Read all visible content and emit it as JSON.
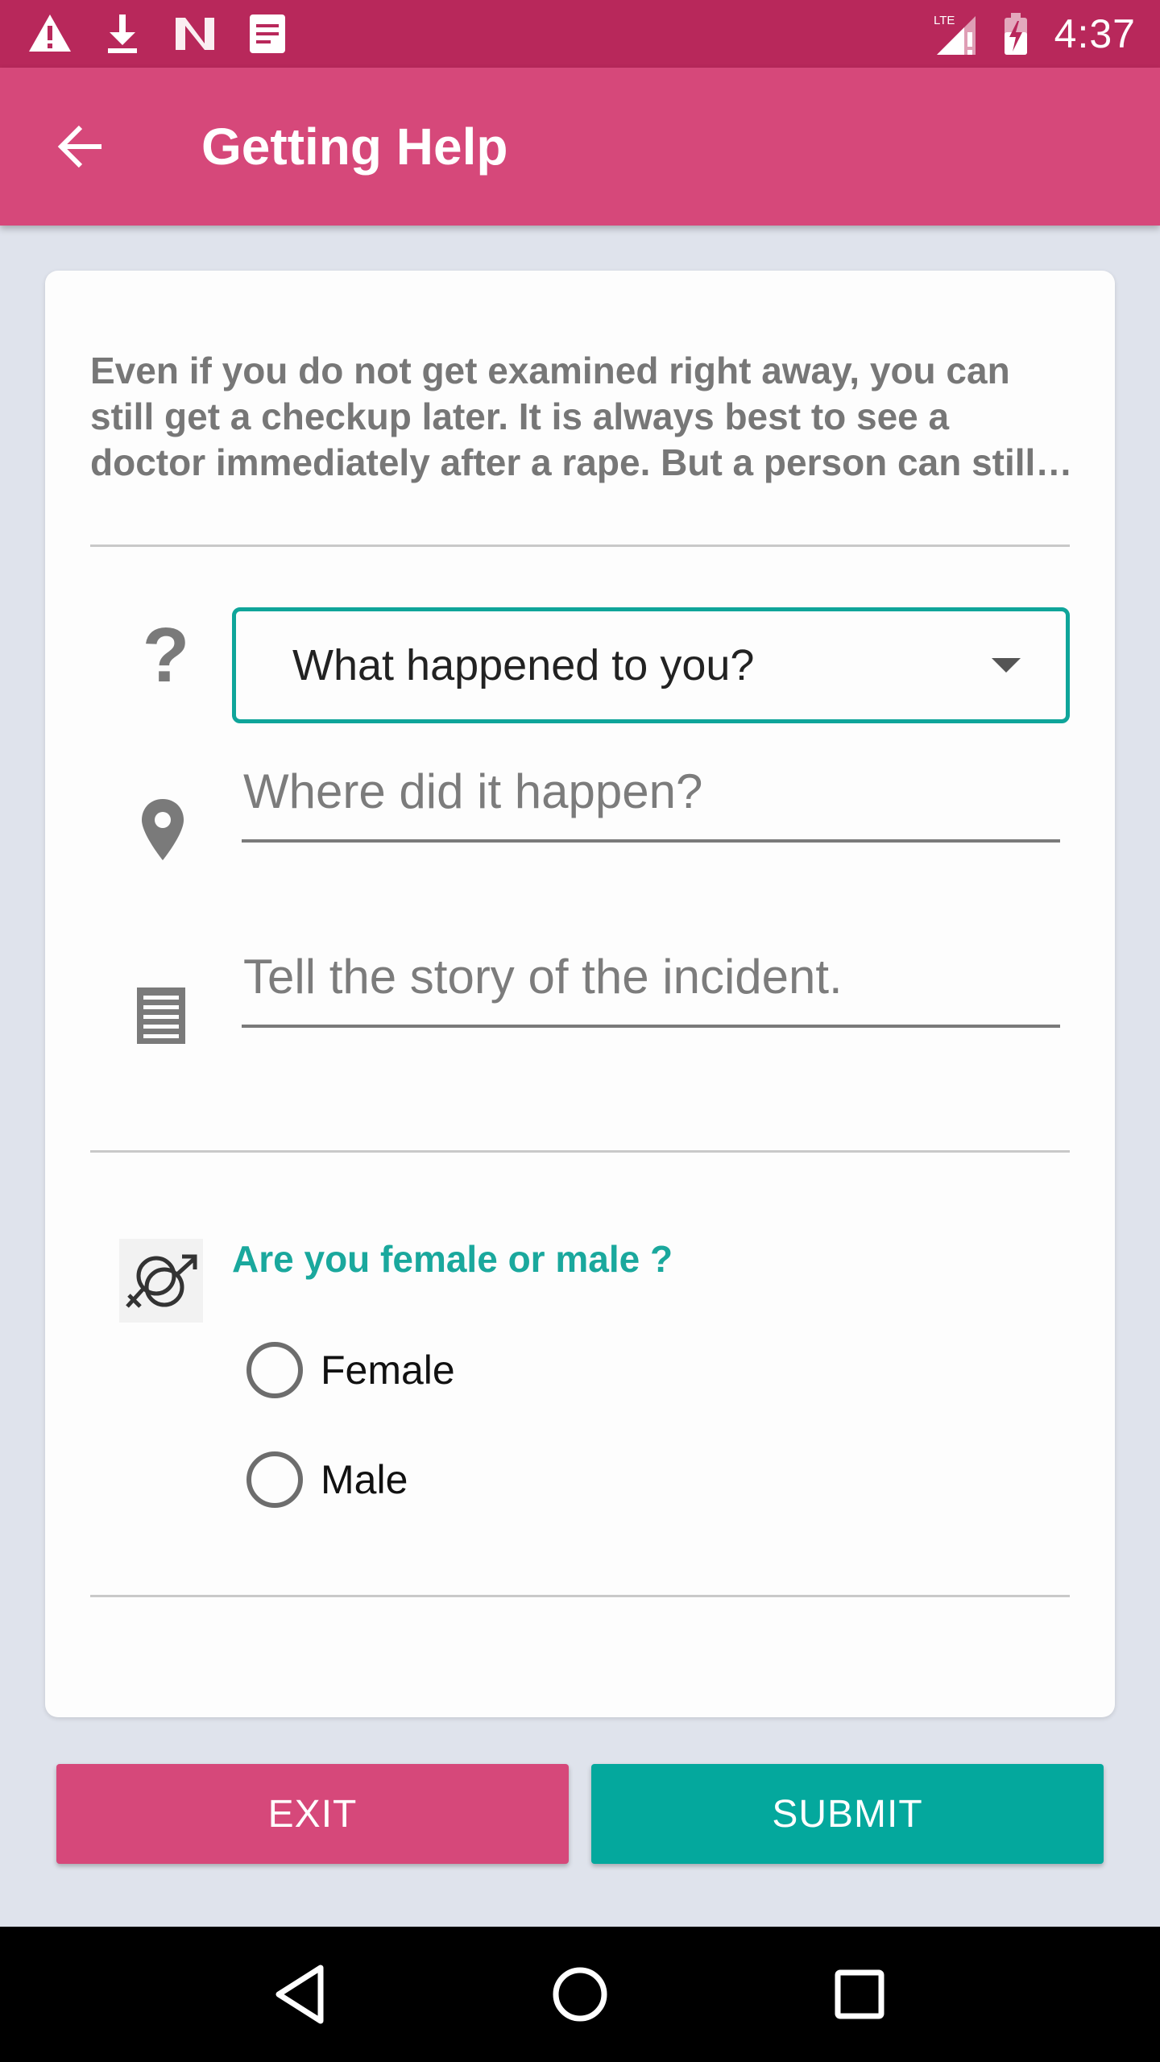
{
  "status_bar": {
    "time": "4:37",
    "left_icons": [
      "warning-icon",
      "download-icon",
      "n-logo-icon",
      "document-icon"
    ],
    "right_icons": [
      "lte-signal-icon",
      "battery-charging-icon"
    ],
    "lte_label": "LTE"
  },
  "app_bar": {
    "title": "Getting Help"
  },
  "card": {
    "intro_text": "Even if you do not get examined right away, you can still get a checkup later. It is always best to see a doctor immediately after a rape. But a person can still get a checkup later and receive needed care.",
    "what_happened": {
      "icon": "question-icon",
      "selected_label": "What happened to you?"
    },
    "where": {
      "icon": "location-pin-icon",
      "placeholder": "Where did it happen?"
    },
    "story": {
      "icon": "notes-icon",
      "placeholder": "Tell the story of the incident."
    },
    "gender": {
      "icon": "gender-icon",
      "question": "Are you female or male ?",
      "options": [
        {
          "label": "Female",
          "selected": false
        },
        {
          "label": "Male",
          "selected": false
        }
      ]
    }
  },
  "buttons": {
    "exit": "EXIT",
    "submit": "SUBMIT"
  },
  "colors": {
    "status_bar": "#b8285b",
    "app_bar": "#d6487a",
    "accent_teal": "#04a89d",
    "exit_button": "#d6487a"
  }
}
